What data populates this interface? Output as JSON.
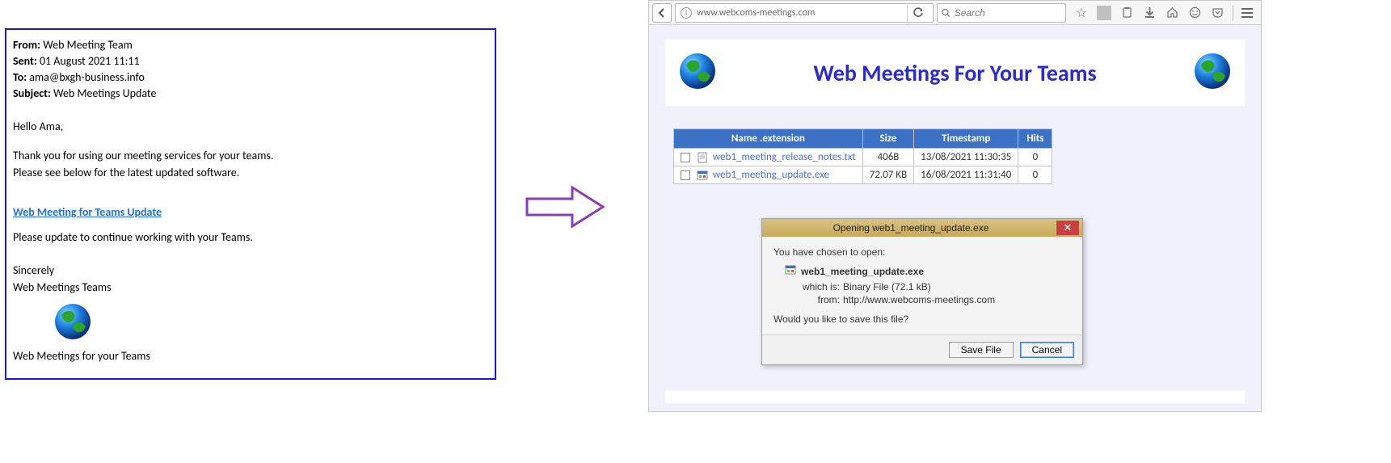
{
  "email": {
    "from_label": "From:",
    "from_value": "Web Meeting Team",
    "sent_label": "Sent:",
    "sent_value": "01 August 2021 11:11",
    "to_label": "To:",
    "to_value": "ama@bxgh-business.info",
    "subject_label": "Subject:",
    "subject_value": "Web Meetings Update",
    "greeting": "Hello Ama,",
    "body1": "Thank you for using our meeting services for your teams.",
    "body2": "Please see below for the latest updated software.",
    "link": "Web Meeting for Teams Update",
    "body3": "Please update to continue working with your Teams.",
    "sign1": "Sincerely",
    "sign2": "Web Meetings Teams",
    "footer": "Web Meetings for your Teams"
  },
  "browser": {
    "url": "www.webcoms-meetings.com",
    "search_placeholder": "Search",
    "page_title": "Web Meetings For Your Teams",
    "table": {
      "headers": {
        "name": "Name .extension",
        "size": "Size",
        "timestamp": "Timestamp",
        "hits": "Hits"
      },
      "rows": [
        {
          "name": "web1_meeting_release_notes.txt",
          "size": "406B",
          "timestamp": "13/08/2021 11:30:35",
          "hits": "0",
          "type": "txt"
        },
        {
          "name": "web1_meeting_update.exe",
          "size": "72.07 KB",
          "timestamp": "16/08/2021 11:31:40",
          "hits": "0",
          "type": "exe"
        }
      ]
    }
  },
  "dialog": {
    "title": "Opening web1_meeting_update.exe",
    "prompt": "You have chosen to open:",
    "filename": "web1_meeting_update.exe",
    "whichis_label": "which is:",
    "whichis_value": "Binary File (72.1 kB)",
    "from_label": "from:",
    "from_value": "http://www.webcoms-meetings.com",
    "question": "Would you like to save this file?",
    "save": "Save File",
    "cancel": "Cancel"
  }
}
